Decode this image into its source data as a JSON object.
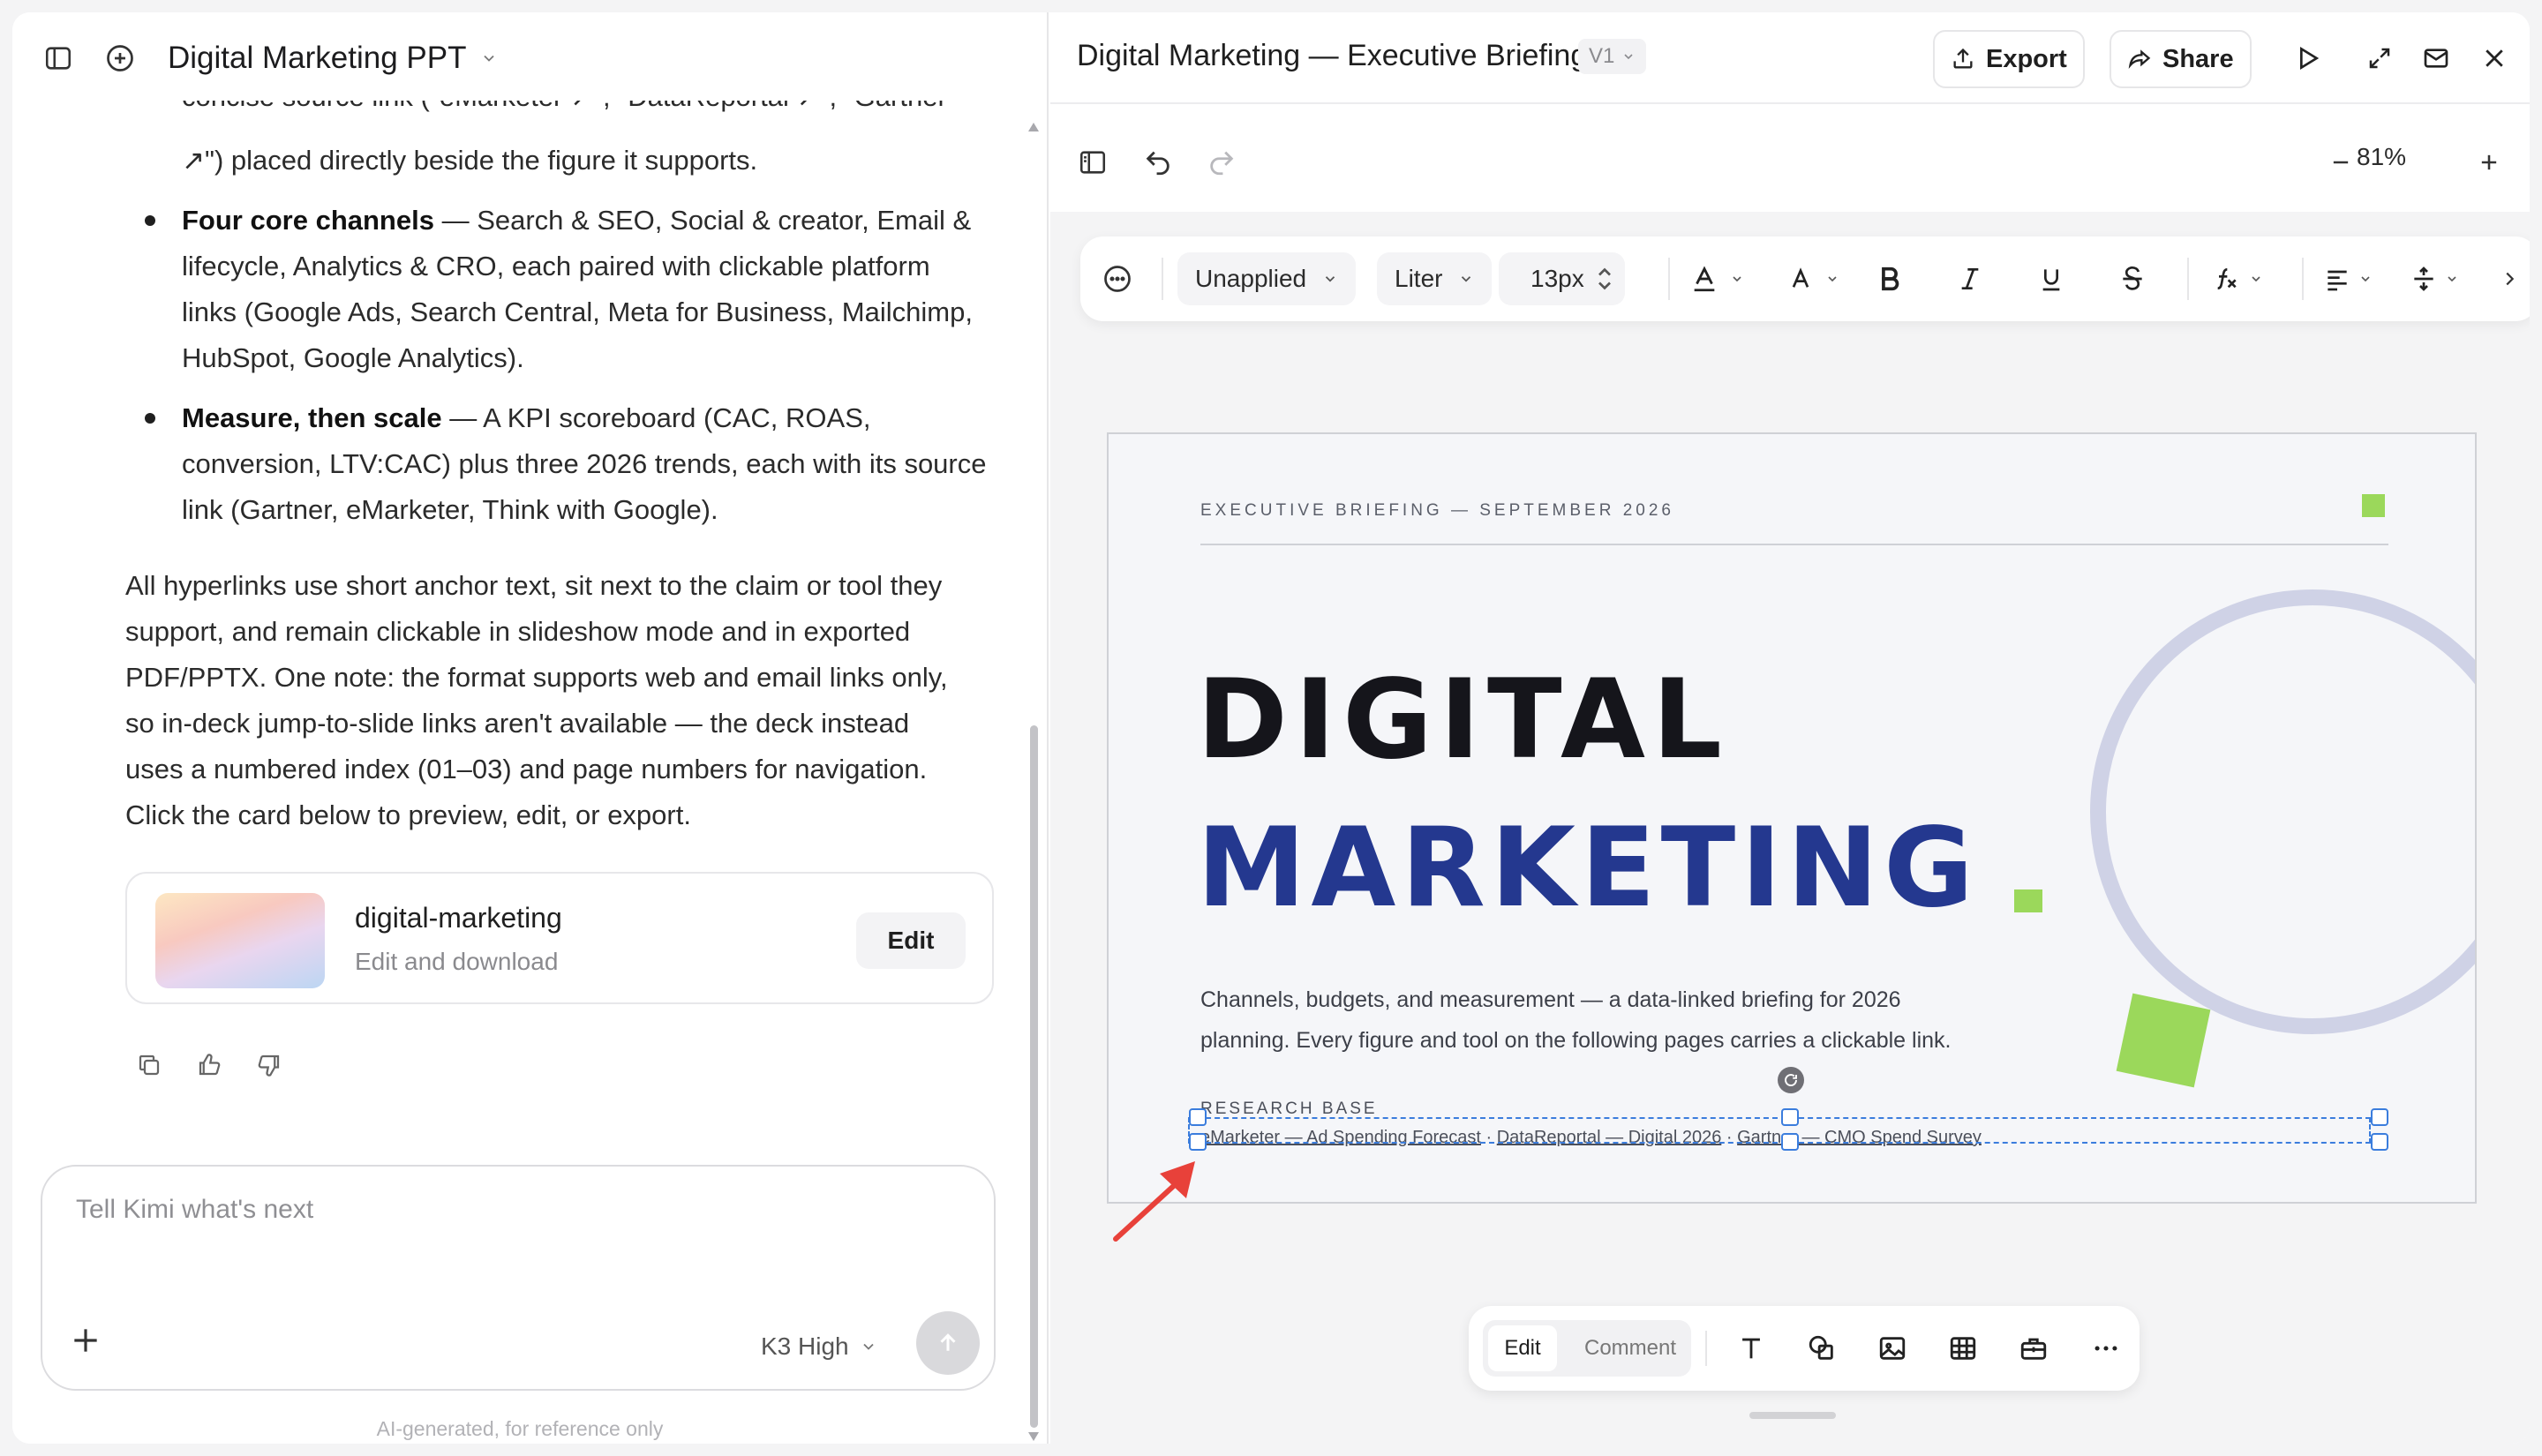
{
  "left": {
    "doc_title": "Digital Marketing PPT",
    "para_top_line1": "concise source link (\"eMarketer ↗\", \"DataReportal ↗\", \"Gartner",
    "para_top_line2": "↗\") placed directly beside the figure it supports.",
    "bullets": [
      {
        "bold": "Four core channels",
        "lines": [
          " — Search & SEO, Social & creator, Email &",
          "lifecycle, Analytics & CRO, each paired with clickable platform",
          "links (Google Ads, Search Central, Meta for Business, Mailchimp,",
          "HubSpot, Google Analytics)."
        ]
      },
      {
        "bold": "Measure, then scale",
        "lines": [
          " — A KPI scoreboard (CAC, ROAS,",
          "conversion, LTV:CAC) plus three 2026 trends, each with its source",
          "link (Gartner, eMarketer, Think with Google)."
        ]
      }
    ],
    "para_lines": [
      "All hyperlinks use short anchor text, sit next to the claim or tool they",
      "support, and remain clickable in slideshow mode and in exported",
      "PDF/PPTX. One note: the format supports web and email links only,",
      "so in-deck jump-to-slide links aren't available — the deck instead",
      "uses a numbered index (01–03) and page numbers for navigation.",
      "Click the card below to preview, edit, or export."
    ],
    "card": {
      "title": "digital-marketing",
      "subtitle": "Edit and download",
      "edit_label": "Edit"
    },
    "input": {
      "placeholder": "Tell Kimi what's next",
      "model": "K3 High"
    },
    "disclaimer": "AI-generated, for reference only"
  },
  "right": {
    "title": "Digital Marketing — Executive Briefing",
    "version": "V1",
    "export_label": "Export",
    "share_label": "Share",
    "zoom": "81%",
    "format": {
      "style": "Unapplied",
      "font": "Liter",
      "size": "13px"
    },
    "slide": {
      "kicker": "EXECUTIVE BRIEFING — SEPTEMBER 2026",
      "headline_1": "DIGITAL",
      "headline_2": "MARKETING",
      "description_line1": "Channels, budgets, and measurement — a data-linked briefing for 2026",
      "description_line2": "planning. Every figure and tool on the following pages carries a clickable link.",
      "research_base": "RESEARCH BASE",
      "links": [
        "eMarketer — Ad Spending Forecast",
        "DataReportal — Digital 2026",
        "Gartner — CMO Spend Survey"
      ],
      "separator": " · "
    },
    "bottom_toolbar": {
      "edit_label": "Edit",
      "comment_label": "Comment"
    }
  },
  "colors": {
    "headline_dark": "#15151b",
    "headline_blue": "#24388f",
    "accent_green": "#9bd85b",
    "ring": "#cfd2e6",
    "selection": "#3b7ddd",
    "annotation_arrow": "#e8413a"
  }
}
